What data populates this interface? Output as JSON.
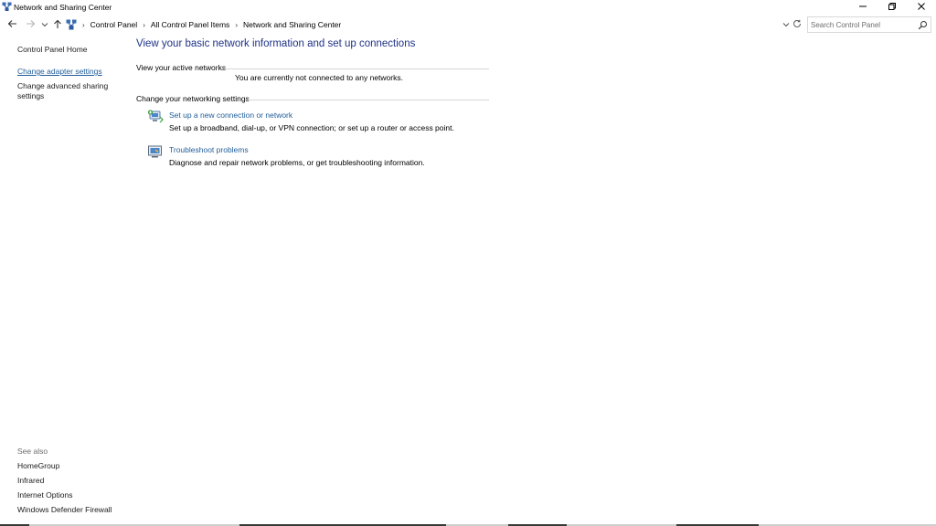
{
  "window": {
    "title": "Network and Sharing Center",
    "icons": {
      "app": "network-sharing-icon",
      "minimize": "minimize-icon",
      "maximize": "restore-icon",
      "close": "close-icon"
    }
  },
  "navigation": {
    "icons": {
      "back": "back-arrow-icon",
      "forward": "forward-arrow-icon",
      "recent": "chevron-down-icon",
      "up": "up-arrow-icon",
      "refresh": "refresh-icon"
    },
    "breadcrumb": [
      "Control Panel",
      "All Control Panel Items",
      "Network and Sharing Center"
    ],
    "search": {
      "placeholder": "Search Control Panel",
      "value": ""
    }
  },
  "left_pane": {
    "home": "Control Panel Home",
    "links": [
      "Change adapter settings",
      "Change advanced sharing settings"
    ],
    "see_also_heading": "See also",
    "see_also": [
      "HomeGroup",
      "Infrared",
      "Internet Options",
      "Windows Defender Firewall"
    ]
  },
  "main": {
    "title": "View your basic network information and set up connections",
    "active_networks": {
      "heading": "View your active networks",
      "status": "You are currently not connected to any networks."
    },
    "change_settings": {
      "heading": "Change your networking settings",
      "tasks": [
        {
          "icon": "network-setup-icon",
          "link": "Set up a new connection or network",
          "description": "Set up a broadband, dial-up, or VPN connection; or set up a router or access point."
        },
        {
          "icon": "troubleshoot-icon",
          "link": "Troubleshoot problems",
          "description": "Diagnose and repair network problems, or get troubleshooting information."
        }
      ]
    }
  },
  "colors": {
    "link": "#1f5d99",
    "title": "#1e3287",
    "muted": "#6d6d6d"
  }
}
